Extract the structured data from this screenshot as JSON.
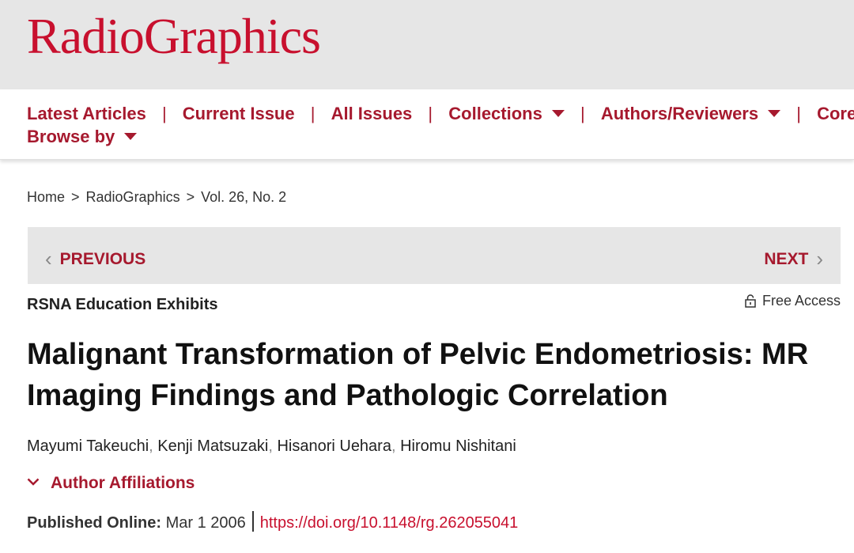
{
  "header": {
    "logo": "RadioGraphics"
  },
  "nav": {
    "items": [
      {
        "label": "Latest Articles"
      },
      {
        "label": "Current Issue"
      },
      {
        "label": "All Issues"
      },
      {
        "label": "Collections"
      },
      {
        "label": "Authors/Reviewers"
      },
      {
        "label": "Core"
      }
    ],
    "separator": "|",
    "browse_by": "Browse by"
  },
  "breadcrumb": {
    "items": [
      "Home",
      "RadioGraphics",
      "Vol. 26, No. 2"
    ],
    "separator": ">"
  },
  "pager": {
    "previous": "PREVIOUS",
    "next": "NEXT"
  },
  "article": {
    "section": "RSNA Education Exhibits",
    "access": "Free Access",
    "title": "Malignant Transformation of Pelvic Endometriosis: MR Imaging Findings and Pathologic Correlation",
    "authors": [
      "Mayumi Takeuchi",
      "Kenji Matsuzaki",
      "Hisanori Uehara",
      "Hiromu Nishitani"
    ],
    "affiliations_label": "Author Affiliations",
    "published_label": "Published Online:",
    "published_date": "Mar 1 2006",
    "doi": "https://doi.org/10.1148/rg.262055041"
  },
  "colors": {
    "brand": "#c8102e",
    "link": "#a6192e",
    "header_bg": "#e6e6e6"
  }
}
